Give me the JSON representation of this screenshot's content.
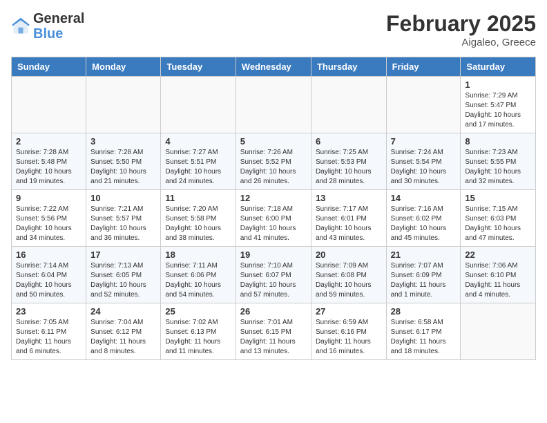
{
  "header": {
    "logo_general": "General",
    "logo_blue": "Blue",
    "month_year": "February 2025",
    "location": "Aigaleo, Greece"
  },
  "weekdays": [
    "Sunday",
    "Monday",
    "Tuesday",
    "Wednesday",
    "Thursday",
    "Friday",
    "Saturday"
  ],
  "weeks": [
    [
      {
        "day": "",
        "info": ""
      },
      {
        "day": "",
        "info": ""
      },
      {
        "day": "",
        "info": ""
      },
      {
        "day": "",
        "info": ""
      },
      {
        "day": "",
        "info": ""
      },
      {
        "day": "",
        "info": ""
      },
      {
        "day": "1",
        "info": "Sunrise: 7:29 AM\nSunset: 5:47 PM\nDaylight: 10 hours and 17 minutes."
      }
    ],
    [
      {
        "day": "2",
        "info": "Sunrise: 7:28 AM\nSunset: 5:48 PM\nDaylight: 10 hours and 19 minutes."
      },
      {
        "day": "3",
        "info": "Sunrise: 7:28 AM\nSunset: 5:50 PM\nDaylight: 10 hours and 21 minutes."
      },
      {
        "day": "4",
        "info": "Sunrise: 7:27 AM\nSunset: 5:51 PM\nDaylight: 10 hours and 24 minutes."
      },
      {
        "day": "5",
        "info": "Sunrise: 7:26 AM\nSunset: 5:52 PM\nDaylight: 10 hours and 26 minutes."
      },
      {
        "day": "6",
        "info": "Sunrise: 7:25 AM\nSunset: 5:53 PM\nDaylight: 10 hours and 28 minutes."
      },
      {
        "day": "7",
        "info": "Sunrise: 7:24 AM\nSunset: 5:54 PM\nDaylight: 10 hours and 30 minutes."
      },
      {
        "day": "8",
        "info": "Sunrise: 7:23 AM\nSunset: 5:55 PM\nDaylight: 10 hours and 32 minutes."
      }
    ],
    [
      {
        "day": "9",
        "info": "Sunrise: 7:22 AM\nSunset: 5:56 PM\nDaylight: 10 hours and 34 minutes."
      },
      {
        "day": "10",
        "info": "Sunrise: 7:21 AM\nSunset: 5:57 PM\nDaylight: 10 hours and 36 minutes."
      },
      {
        "day": "11",
        "info": "Sunrise: 7:20 AM\nSunset: 5:58 PM\nDaylight: 10 hours and 38 minutes."
      },
      {
        "day": "12",
        "info": "Sunrise: 7:18 AM\nSunset: 6:00 PM\nDaylight: 10 hours and 41 minutes."
      },
      {
        "day": "13",
        "info": "Sunrise: 7:17 AM\nSunset: 6:01 PM\nDaylight: 10 hours and 43 minutes."
      },
      {
        "day": "14",
        "info": "Sunrise: 7:16 AM\nSunset: 6:02 PM\nDaylight: 10 hours and 45 minutes."
      },
      {
        "day": "15",
        "info": "Sunrise: 7:15 AM\nSunset: 6:03 PM\nDaylight: 10 hours and 47 minutes."
      }
    ],
    [
      {
        "day": "16",
        "info": "Sunrise: 7:14 AM\nSunset: 6:04 PM\nDaylight: 10 hours and 50 minutes."
      },
      {
        "day": "17",
        "info": "Sunrise: 7:13 AM\nSunset: 6:05 PM\nDaylight: 10 hours and 52 minutes."
      },
      {
        "day": "18",
        "info": "Sunrise: 7:11 AM\nSunset: 6:06 PM\nDaylight: 10 hours and 54 minutes."
      },
      {
        "day": "19",
        "info": "Sunrise: 7:10 AM\nSunset: 6:07 PM\nDaylight: 10 hours and 57 minutes."
      },
      {
        "day": "20",
        "info": "Sunrise: 7:09 AM\nSunset: 6:08 PM\nDaylight: 10 hours and 59 minutes."
      },
      {
        "day": "21",
        "info": "Sunrise: 7:07 AM\nSunset: 6:09 PM\nDaylight: 11 hours and 1 minute."
      },
      {
        "day": "22",
        "info": "Sunrise: 7:06 AM\nSunset: 6:10 PM\nDaylight: 11 hours and 4 minutes."
      }
    ],
    [
      {
        "day": "23",
        "info": "Sunrise: 7:05 AM\nSunset: 6:11 PM\nDaylight: 11 hours and 6 minutes."
      },
      {
        "day": "24",
        "info": "Sunrise: 7:04 AM\nSunset: 6:12 PM\nDaylight: 11 hours and 8 minutes."
      },
      {
        "day": "25",
        "info": "Sunrise: 7:02 AM\nSunset: 6:13 PM\nDaylight: 11 hours and 11 minutes."
      },
      {
        "day": "26",
        "info": "Sunrise: 7:01 AM\nSunset: 6:15 PM\nDaylight: 11 hours and 13 minutes."
      },
      {
        "day": "27",
        "info": "Sunrise: 6:59 AM\nSunset: 6:16 PM\nDaylight: 11 hours and 16 minutes."
      },
      {
        "day": "28",
        "info": "Sunrise: 6:58 AM\nSunset: 6:17 PM\nDaylight: 11 hours and 18 minutes."
      },
      {
        "day": "",
        "info": ""
      }
    ]
  ]
}
